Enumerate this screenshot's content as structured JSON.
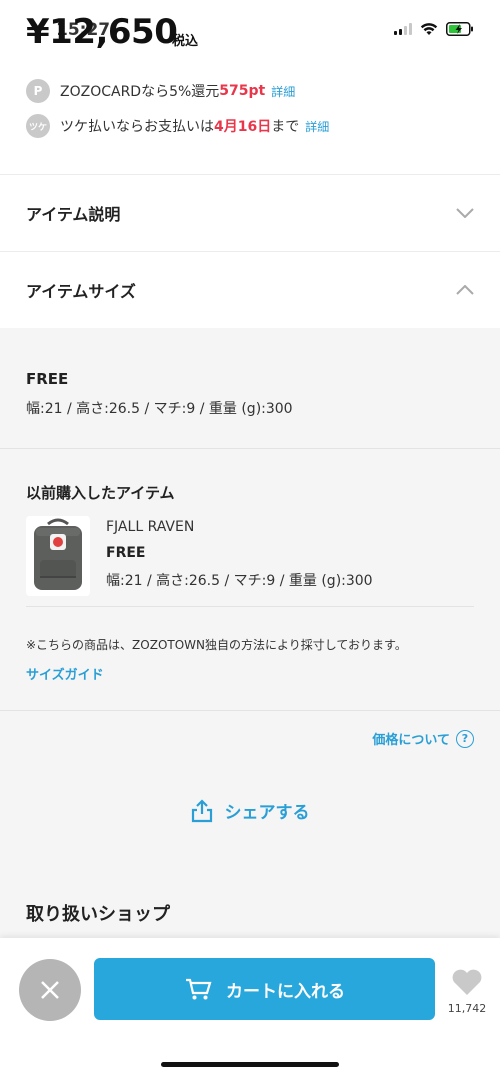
{
  "status_bar": {
    "time": "15:27"
  },
  "price": {
    "amount": "¥12,650",
    "tax_label": "税込"
  },
  "benefits": [
    {
      "icon": "P",
      "text_before": "ZOZOCARDなら5%還元 ",
      "highlight": "575pt",
      "text_after": "",
      "link": "詳細"
    },
    {
      "icon": "ツケ",
      "text_before": "ツケ払いならお支払いは",
      "highlight": "4月16日",
      "text_after": "まで",
      "link": "詳細"
    }
  ],
  "accordions": [
    {
      "label": "アイテム説明",
      "state": "collapsed"
    },
    {
      "label": "アイテムサイズ",
      "state": "expanded"
    }
  ],
  "item_size": {
    "size": "FREE",
    "dimensions": "幅:21 / 高さ:26.5 / マチ:9 / 重量 (g):300"
  },
  "previous_purchase": {
    "title": "以前購入したアイテム",
    "brand": "FJALL RAVEN",
    "size": "FREE",
    "dimensions": "幅:21 / 高さ:26.5 / マチ:9 / 重量 (g):300"
  },
  "note": "※こちらの商品は、ZOZOTOWN独自の方法により採寸しております。",
  "size_guide": "サイズガイド",
  "price_about": {
    "label": "価格について",
    "icon": "?"
  },
  "share": {
    "label": "シェアする"
  },
  "shop_section_title": "取り扱いショップ",
  "bottom_bar": {
    "cart_label": "カートに入れる",
    "favorite_count": "11,742"
  },
  "colors": {
    "accent": "#27a7dc",
    "red": "#e8374b",
    "link": "#2a9fd6",
    "battery": "#2ec43a"
  }
}
